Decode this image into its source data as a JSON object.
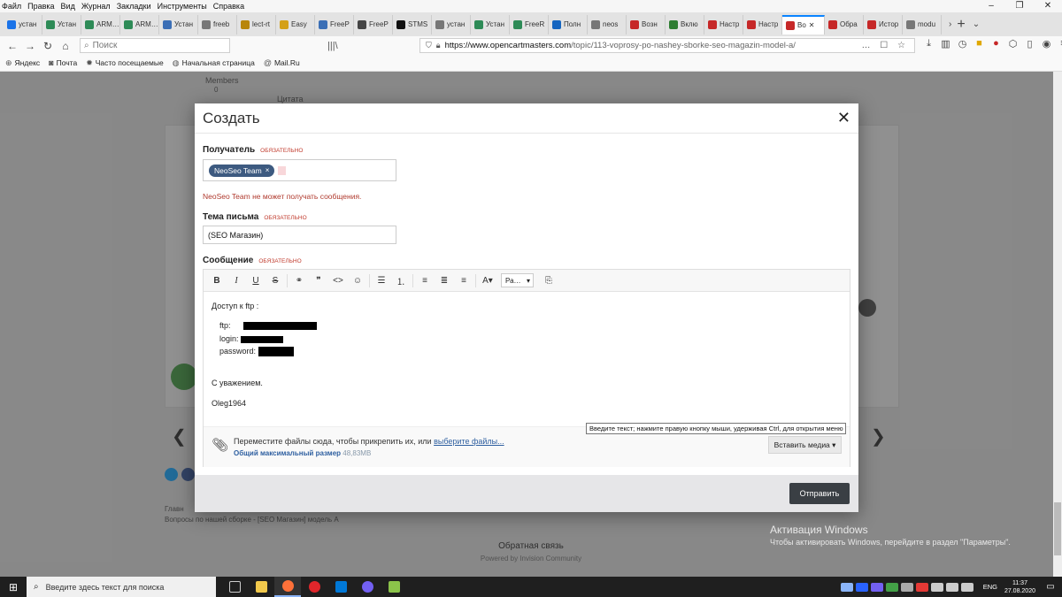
{
  "menubar": {
    "items": [
      "Файл",
      "Правка",
      "Вид",
      "Журнал",
      "Закладки",
      "Инструменты",
      "Справка"
    ]
  },
  "tabs": [
    {
      "label": "устан",
      "color": "#1a73e8"
    },
    {
      "label": "Устан",
      "color": "#2e8b57"
    },
    {
      "label": "ARM…",
      "color": "#2e8b57"
    },
    {
      "label": "ARM…",
      "color": "#2e8b57"
    },
    {
      "label": "Устан",
      "color": "#3b6fb6"
    },
    {
      "label": "freeb",
      "color": "#777777"
    },
    {
      "label": "lect-rt",
      "color": "#b8860b"
    },
    {
      "label": "Easy",
      "color": "#d4a017"
    },
    {
      "label": "FreeP",
      "color": "#3b6fb6"
    },
    {
      "label": "FreeP",
      "color": "#444444"
    },
    {
      "label": "STMS",
      "color": "#111111"
    },
    {
      "label": "устан",
      "color": "#777777"
    },
    {
      "label": "Устан",
      "color": "#2e8b57"
    },
    {
      "label": "FreeR",
      "color": "#2e8b57"
    },
    {
      "label": "Полн",
      "color": "#1565c0"
    },
    {
      "label": "neos",
      "color": "#777777"
    },
    {
      "label": "Возн",
      "color": "#c62828"
    },
    {
      "label": "Вклю",
      "color": "#2e7d32"
    },
    {
      "label": "Настр",
      "color": "#c62828"
    },
    {
      "label": "Настр",
      "color": "#c62828"
    },
    {
      "label": "Во",
      "color": "#c62828",
      "active": true
    },
    {
      "label": "Обра",
      "color": "#c62828"
    },
    {
      "label": "Истор",
      "color": "#c62828"
    },
    {
      "label": "modu",
      "color": "#777777"
    }
  ],
  "navbar": {
    "search_placeholder": "Поиск",
    "url_host": "https://www.opencartmasters.com",
    "url_path": "/topic/113-voprosy-po-nashey-sborke-seo-magazin-model-a/"
  },
  "bookmarks": [
    {
      "label": "Яндекс",
      "icon": "yandex-icon"
    },
    {
      "label": "Почта",
      "icon": "mail-icon"
    },
    {
      "label": "Часто посещаемые",
      "icon": "gear-icon"
    },
    {
      "label": "Начальная страница",
      "icon": "globe-icon"
    },
    {
      "label": "Mail.Ru",
      "icon": "mailru-icon"
    }
  ],
  "background": {
    "members_label": "Members",
    "members_count": "0",
    "citata": "Цитата",
    "breadcrumb": "Главн",
    "breadcrumb2": "Вопросы по нашей сборке - [SEO Магазин] модель А",
    "feedback": "Обратная связь",
    "powered": "Powered by Invision Community"
  },
  "modal": {
    "title": "Создать",
    "recipient_label": "Получатель",
    "required_label": "ОБЯЗАТЕЛЬНО",
    "recipient_token": "NeoSeo Team",
    "recipient_error": "NeoSeo Team не может получать сообщения.",
    "subject_label": "Тема письма",
    "subject_value": "(SEO Магазин)",
    "message_label": "Сообщение",
    "font_select": "Ра…",
    "message": {
      "line1": "Доступ к ftp :",
      "ftp_label": "ftp:",
      "login_label": "login:",
      "password_label": "password:",
      "regards": "С уважением.",
      "signature": "Oleg1964"
    },
    "attach": {
      "text": "Переместите файлы сюда, чтобы прикрепить их, или",
      "link": "выберите файлы...",
      "max_label": "Общий максимальный размер",
      "max_value": "48,83MB",
      "media_button": "Вставить медиа ▾"
    },
    "send_button": "Отправить"
  },
  "tooltip": "Введите текст; нажмите правую кнопку мыши, удерживая Ctrl, для открытия меню",
  "activation": {
    "title": "Активация Windows",
    "subtitle": "Чтобы активировать Windows, перейдите в раздел \"Параметры\"."
  },
  "taskbar": {
    "search_placeholder": "Введите здесь текст для поиска",
    "lang": "ENG",
    "time": "11:37",
    "date": "27.08.2020"
  }
}
